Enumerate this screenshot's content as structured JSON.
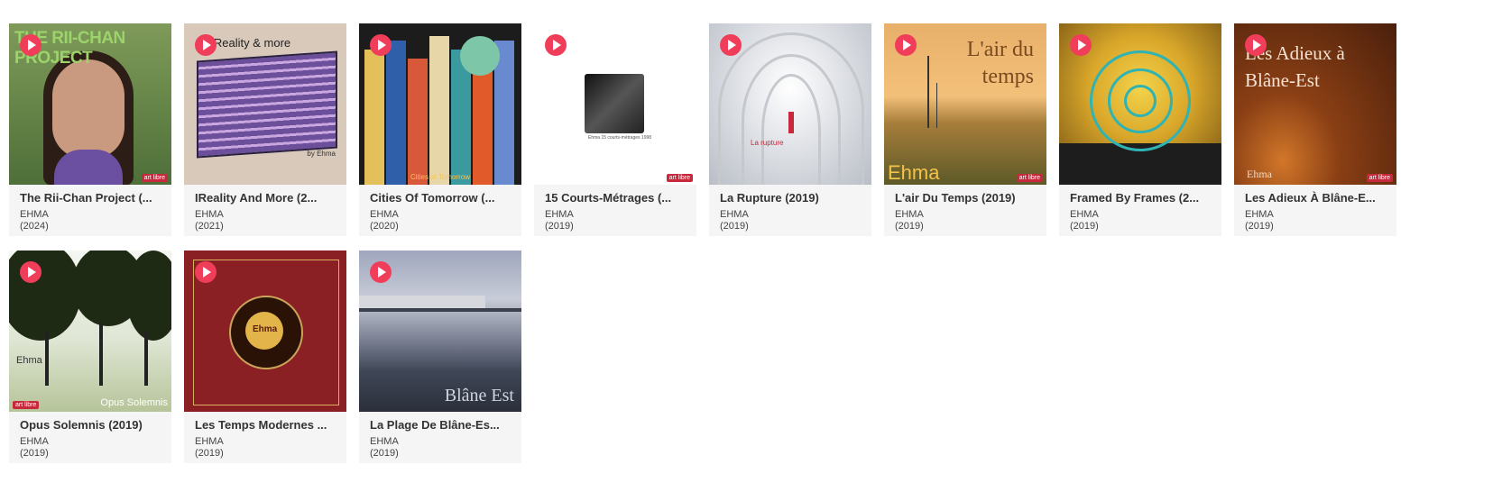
{
  "albums": [
    {
      "title": "The Rii-Chan Project (...",
      "artist": "EHMA",
      "year": "(2024)",
      "cover_text": "THE RII-CHAN PROJECT",
      "license": "art libre"
    },
    {
      "title": "IReality And More (2...",
      "artist": "EHMA",
      "year": "(2021)",
      "cover_text": "lReality & more",
      "cover_sub": "by Ehma"
    },
    {
      "title": "Cities Of Tomorrow (...",
      "artist": "EHMA",
      "year": "(2020)",
      "cover_text": "Cities of Tomorrow"
    },
    {
      "title": "15 Courts-Métrages (...",
      "artist": "EHMA",
      "year": "(2019)",
      "cover_text": "Ehma 15 courts-métrages 1998",
      "license": "art libre"
    },
    {
      "title": "La Rupture (2019)",
      "artist": "EHMA",
      "year": "(2019)",
      "cover_text": "La rupture"
    },
    {
      "title": "L'air Du Temps (2019)",
      "artist": "EHMA",
      "year": "(2019)",
      "cover_text": "L'air du temps",
      "cover_sub": "Ehma",
      "license": "art libre"
    },
    {
      "title": "Framed By Frames (2...",
      "artist": "EHMA",
      "year": "(2019)"
    },
    {
      "title": "Les Adieux À Blâne-E...",
      "artist": "EHMA",
      "year": "(2019)",
      "cover_text": "Les Adieux à Blâne-Est",
      "cover_sub": "Ehma",
      "license": "art libre"
    },
    {
      "title": "Opus Solemnis (2019)",
      "artist": "EHMA",
      "year": "(2019)",
      "cover_text": "Opus Solemnis",
      "cover_sub": "Ehma",
      "license": "art libre"
    },
    {
      "title": "Les Temps Modernes ...",
      "artist": "EHMA",
      "year": "(2019)",
      "cover_text": "Ehma"
    },
    {
      "title": "La Plage De Blâne-Es...",
      "artist": "EHMA",
      "year": "(2019)",
      "cover_text": "Blâne Est"
    }
  ],
  "icons": {
    "play": "play-icon"
  },
  "colors": {
    "play_button": "#ef3d5a",
    "card_bg": "#f5f5f5"
  }
}
